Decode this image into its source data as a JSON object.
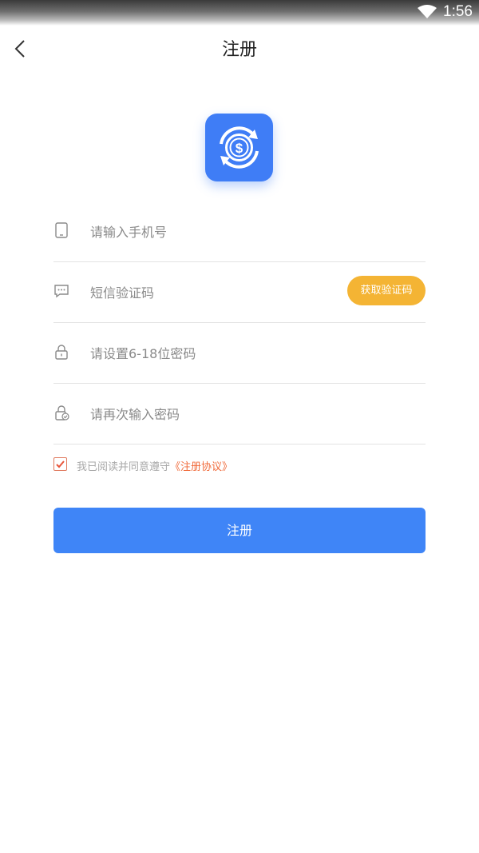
{
  "status_bar": {
    "time": "1:56",
    "wifi_icon": "wifi-icon"
  },
  "header": {
    "title": "注册",
    "back_icon": "chevron-left-icon"
  },
  "logo": {
    "icon": "dollar-refresh-icon",
    "color": "#3f7df6"
  },
  "form": {
    "phone": {
      "placeholder": "请输入手机号",
      "value": "",
      "icon": "phone-icon"
    },
    "sms_code": {
      "placeholder": "短信验证码",
      "value": "",
      "icon": "message-icon",
      "button_label": "获取验证码"
    },
    "password": {
      "placeholder": "请设置6-18位密码",
      "value": "",
      "icon": "lock-icon"
    },
    "confirm_password": {
      "placeholder": "请再次输入密码",
      "value": "",
      "icon": "lock-check-icon"
    }
  },
  "agreement": {
    "checked": true,
    "text": "我已阅读并同意遵守",
    "link_text": "《注册协议》"
  },
  "submit": {
    "label": "注册"
  },
  "colors": {
    "primary": "#3f85f7",
    "sms_button": "#f4b434",
    "link": "#f06a3a"
  }
}
